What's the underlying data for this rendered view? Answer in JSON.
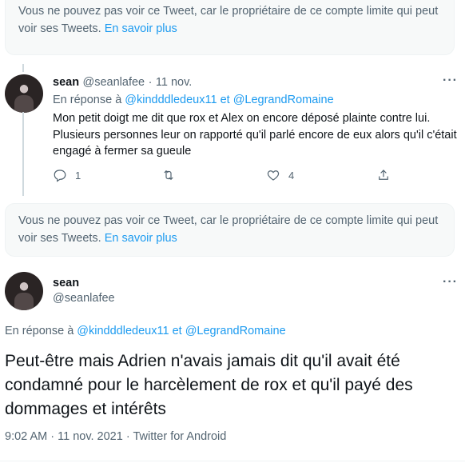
{
  "notice_top": {
    "text": "Vous ne pouvez pas voir ce Tweet, car le propriétaire de ce compte limite qui peut voir ses Tweets.",
    "link": "En savoir plus"
  },
  "reply_tweet": {
    "display_name": "sean",
    "handle": "@seanlafee",
    "separator": "·",
    "date": "11 nov.",
    "reply_prefix": "En réponse à",
    "mention1": "@kindddledeux11",
    "conjunction": "et",
    "mention2": "@LegrandRomaine",
    "text": "Mon petit doigt me dit que rox et Alex on encore déposé plainte contre lui. Plusieurs personnes leur on rapporté qu'il parlé encore de eux alors qu'il c'était engagé à fermer sa gueule",
    "reply_count": "1",
    "like_count": "4",
    "more": "···"
  },
  "notice_bottom": {
    "text": "Vous ne pouvez pas voir ce Tweet, car le propriétaire de ce compte limite qui peut voir ses Tweets.",
    "link": "En savoir plus"
  },
  "main_tweet": {
    "display_name": "sean",
    "handle": "@seanlafee",
    "reply_prefix": "En réponse à",
    "mention1": "@kindddledeux11",
    "conjunction": "et",
    "mention2": "@LegrandRomaine",
    "text": "Peut-être mais Adrien n'avais jamais dit qu'il avait été condamné pour le harcèlement de rox et qu'il payé des dommages et intérêts",
    "time": "9:02 AM",
    "separator": "·",
    "date": "11 nov. 2021",
    "source": "Twitter for Android",
    "more": "···"
  }
}
